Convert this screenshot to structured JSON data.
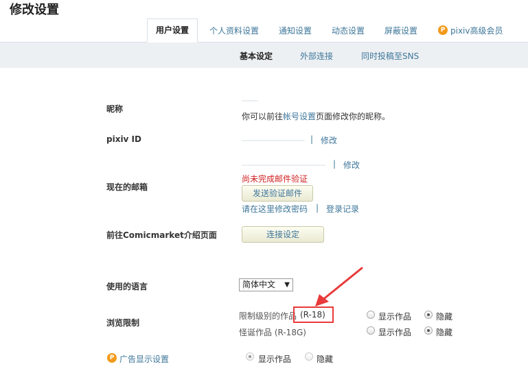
{
  "page_title": "修改设置",
  "tabs": [
    {
      "label": "用户设置"
    },
    {
      "label": "个人资料设置"
    },
    {
      "label": "通知设置"
    },
    {
      "label": "动态设置"
    },
    {
      "label": "屏蔽设置"
    },
    {
      "label": "pixiv高级会员"
    }
  ],
  "subtabs": [
    {
      "label": "基本设定"
    },
    {
      "label": "外部连接"
    },
    {
      "label": "同时投稿至SNS"
    }
  ],
  "nickname": {
    "label": "昵称",
    "hint_prefix": "你可以前往",
    "hint_link": "帐号设置",
    "hint_suffix": "页面修改你的昵称。"
  },
  "pixiv_id": {
    "label": "pixiv ID",
    "sep": "|",
    "edit": "修改"
  },
  "email": {
    "label": "现在的邮箱",
    "sep": "|",
    "edit": "修改",
    "warning": "尚未完成邮件验证",
    "send_button": "发送验证邮件",
    "change_password": "请在这里修改密码",
    "sep2": "|",
    "login_history": "登录记录"
  },
  "comicmarket": {
    "label": "前往Comicmarket介绍页面",
    "button": "连接设定"
  },
  "language": {
    "label": "使用的语言",
    "selected": "简体中文",
    "arrow": "▼"
  },
  "browse_limit": {
    "label": "浏览限制",
    "rows": [
      {
        "text": "限制级别的作品",
        "tag": "(R-18)",
        "show": "显示作品",
        "hide": "隐藏"
      },
      {
        "text": "怪诞作品 (R-18G)",
        "show": "显示作品",
        "hide": "隐藏"
      }
    ]
  },
  "ads": {
    "label": "广告显示设置",
    "icon_letter": "P",
    "show": "显示作品",
    "hide": "隐藏"
  },
  "premium_icon_letter": "P",
  "colors": {
    "accent": "#3d7699",
    "warning": "#d01f1f",
    "annotation": "#e83a3a"
  }
}
